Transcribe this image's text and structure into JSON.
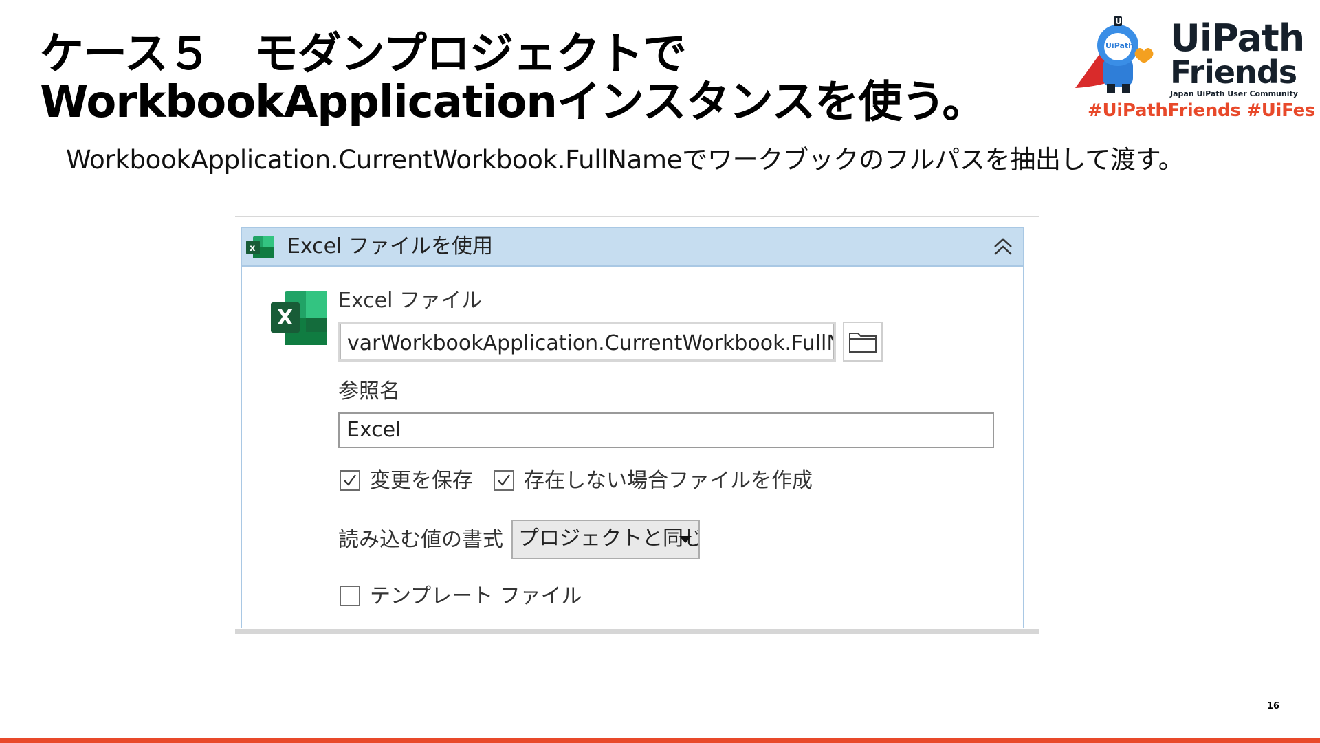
{
  "slide": {
    "title_line1": "ケース５　モダンプロジェクトで",
    "title_line2": "WorkbookApplicationインスタンスを使う。",
    "subtitle": "WorkbookApplication.CurrentWorkbook.FullNameでワークブックのフルパスを抽出して渡す。",
    "page_number": "16"
  },
  "logo": {
    "mascot_badge": "UiPath",
    "mascot_ui": "Ui",
    "word1": "UiPath",
    "word2": "Friends",
    "community": "Japan UiPath User Community",
    "hashtags": "#UiPathFriends  #UiFes"
  },
  "activity": {
    "header_title": "Excel ファイルを使用",
    "excel_file_label": "Excel ファイル",
    "excel_file_value": "varWorkbookApplication.CurrentWorkbook.FullName",
    "reference_label": "参照名",
    "reference_value": "Excel",
    "save_changes_label": "変更を保存",
    "save_changes_checked": true,
    "create_if_missing_label": "存在しない場合ファイルを作成",
    "create_if_missing_checked": true,
    "read_format_label": "読み込む値の書式",
    "read_format_value": "プロジェクトと同じ",
    "template_label": "テンプレート ファイル",
    "template_checked": false
  },
  "colors": {
    "accent": "#e8492a",
    "header_bg": "#c6ddf0",
    "header_border": "#a9c8e4",
    "excel_green": "#1d6f42"
  },
  "icons": {
    "header": "excel-icon",
    "collapse": "chevron-double-up-icon",
    "browse": "folder-icon",
    "checkbox": "checkmark-icon",
    "dropdown": "caret-down-icon"
  }
}
